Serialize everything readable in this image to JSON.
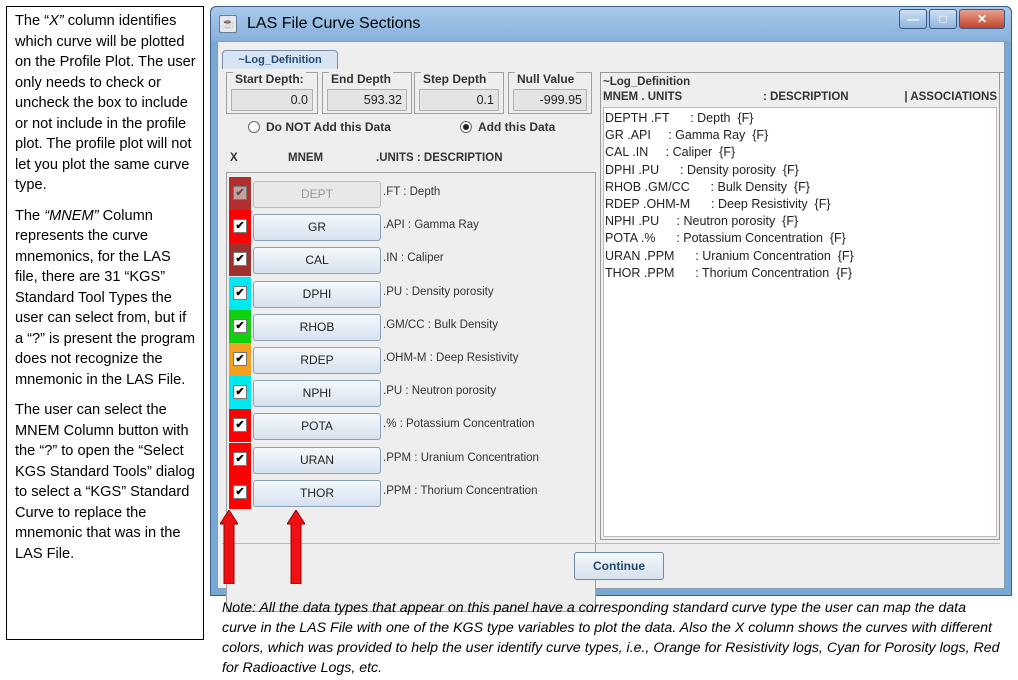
{
  "left_note": {
    "p1a": "The “",
    "p1b": "X”",
    "p1c": " column identifies which curve will be plotted on the Profile Plot.  The user only needs to check or uncheck the box to include or not include in the profile plot.  The profile plot will not let you plot the same curve type.",
    "p2a": "The ",
    "p2b": "“MNEM”",
    "p2c": " Column represents the curve mnemonics, for the LAS file, there are 31 “KGS” Standard Tool Types the user can select from, but if a “?” is present the program does not recognize the  mnemonic in the LAS File.",
    "p3": "The user can select the MNEM Column button with the “?” to open the “Select KGS Standard Tools” dialog to select a “KGS” Standard Curve to replace the mnemonic that was in the LAS File."
  },
  "window": {
    "title": "LAS File Curve Sections",
    "icon": "java-cup-icon"
  },
  "tab": {
    "label": "~Log_Definition"
  },
  "depth": {
    "start_label": "Start Depth:",
    "start_value": "0.0",
    "end_label": "End Depth",
    "end_value": "593.32",
    "step_label": "Step Depth",
    "step_value": "0.1",
    "null_label": "Null Value",
    "null_value": "-999.95"
  },
  "radios": {
    "not_add": "Do NOT Add this Data",
    "add": "Add this Data",
    "selected": "add"
  },
  "columns": {
    "x": "X",
    "mnem": "MNEM",
    "units": ".UNITS   : DESCRIPTION"
  },
  "curves": [
    {
      "mnem": "DEPT",
      "desc": ".FT : Depth",
      "color": "#b03030",
      "checked": true,
      "disabled": true
    },
    {
      "mnem": "GR",
      "desc": ".API : Gamma Ray",
      "color": "#ff0000",
      "checked": true
    },
    {
      "mnem": "CAL",
      "desc": ".IN : Caliper",
      "color": "#a03030",
      "checked": true
    },
    {
      "mnem": "DPHI",
      "desc": ".PU : Density porosity",
      "color": "#00e8f0",
      "checked": true
    },
    {
      "mnem": "RHOB",
      "desc": ".GM/CC : Bulk Density",
      "color": "#10d010",
      "checked": true
    },
    {
      "mnem": "RDEP",
      "desc": ".OHM-M : Deep Resistivity",
      "color": "#f5a020",
      "checked": true
    },
    {
      "mnem": "NPHI",
      "desc": ".PU : Neutron porosity",
      "color": "#00e8f0",
      "checked": true
    },
    {
      "mnem": "POTA",
      "desc": ".% : Potassium Concentration",
      "color": "#ff0000",
      "checked": true
    },
    {
      "mnem": "URAN",
      "desc": ".PPM : Uranium Concentration",
      "color": "#ff0000",
      "checked": true
    },
    {
      "mnem": "THOR",
      "desc": ".PPM : Thorium Concentration",
      "color": "#ff0000",
      "checked": true
    }
  ],
  "right_panel": {
    "header": "~Log_Definition",
    "col1": "MNEM . UNITS",
    "col2": ": DESCRIPTION",
    "col3": "| ASSOCIATIONS",
    "lines": [
      "DEPTH .FT      : Depth  {F}",
      "GR .API     : Gamma Ray  {F}",
      "CAL .IN     : Caliper  {F}",
      "DPHI .PU      : Density porosity  {F}",
      "RHOB .GM/CC      : Bulk Density  {F}",
      "RDEP .OHM-M      : Deep Resistivity  {F}",
      "NPHI .PU     : Neutron porosity  {F}",
      "POTA .%      : Potassium Concentration  {F}",
      "URAN .PPM      : Uranium Concentration  {F}",
      "THOR .PPM      : Thorium Concentration  {F}"
    ]
  },
  "continue_label": "Continue",
  "note": "Note:  All the data types that appear on this panel have a corresponding standard curve type the user can map the data curve in the LAS File with one of the KGS type variables to plot the data.  Also the X column shows the curves with different colors, which was provided to help the user identify curve types, i.e., Orange for Resistivity logs, Cyan for Porosity logs, Red for Radioactive Logs, etc.",
  "arrow_color": "#ee1111"
}
